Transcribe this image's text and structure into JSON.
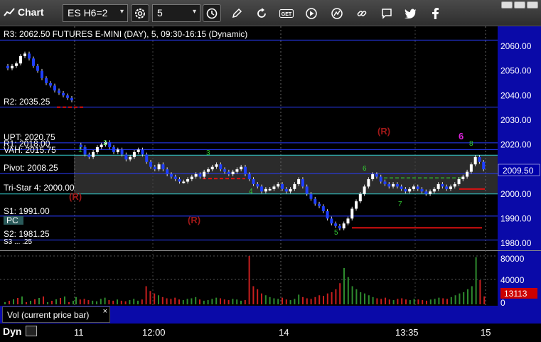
{
  "toolbar": {
    "title": "Chart",
    "symbol": "ES H6=2",
    "interval": "5",
    "icons": [
      "gear-icon",
      "clock-icon",
      "pencil-icon",
      "cycle-icon",
      "get-icon",
      "play-icon",
      "chart-settings-icon",
      "link-icon",
      "chat-icon",
      "twitter-icon",
      "facebook-icon"
    ]
  },
  "chart": {
    "header_text": "R3: 2062.50 FUTURES E-MINI (DAY), 5, 09:30-16:15 (Dynamic)",
    "price_axis": [
      "2060.00",
      "2050.00",
      "2040.00",
      "2030.00",
      "2020.00",
      "2010.00",
      "2000.00",
      "1990.00",
      "1980.00"
    ],
    "current_price": "2009.50",
    "levels": {
      "r2": "R2: 2035.25",
      "upt": "UPT: 2020.75",
      "r1": "R1: 2018.00",
      "vah": "VAH: 2015.75",
      "pivot": "Pivot: 2008.25",
      "tristar": "Tri-Star 4: 2000.00",
      "s1": "S1: 1991.00",
      "s2": "S2: 1981.25",
      "pc": "PC",
      "bottom_small": "S3 ... .25"
    },
    "r_markers": [
      "(R)",
      "(R)",
      "(R)"
    ],
    "vol_axis": [
      "80000",
      "40000",
      "0"
    ],
    "current_volume": "13113",
    "vol_legend": "Vol (current price bar)",
    "vol_close": "×",
    "time_labels": [
      "11",
      "12:00",
      "14",
      "13:35",
      "15"
    ],
    "dyn_label": "Dyn",
    "colors": {
      "up_bar": "#ffffff",
      "down_bar": "#1f3fff",
      "level_blue": "#2a3cff",
      "level_cyan": "#33cccc",
      "red_line": "#dd1111",
      "green_dash": "#2f8a2f",
      "price_flag": "#0000aa",
      "vol_flag": "#cc0000",
      "magenta": "#dd22dd"
    }
  },
  "chart_data": {
    "type": "candlestick",
    "title": "",
    "ylim": [
      1978,
      2066
    ],
    "series": [
      {
        "values": [
          2052,
          2051,
          2052,
          2053,
          2056,
          2057,
          2055,
          2052,
          2050,
          2047,
          2045,
          2044,
          2042,
          2041,
          2040,
          2039,
          2038
        ]
      },
      {
        "values": [
          2020,
          2019,
          2016,
          2015,
          2017,
          2019,
          2020,
          2021,
          2019,
          2017,
          2018,
          2016,
          2014,
          2015,
          2017,
          2018,
          2016,
          2013,
          2011,
          2010,
          2012,
          2010,
          2008,
          2007,
          2006,
          2005,
          2005,
          2006,
          2007,
          2008,
          2007,
          2009,
          2010,
          2011,
          2012,
          2010,
          2009,
          2008,
          2009,
          2010,
          2011,
          2008,
          2006,
          2004,
          2003,
          2001,
          2002,
          2002,
          2003,
          2004,
          2002,
          2001,
          2002,
          2004,
          2006,
          2003,
          2000,
          1998,
          1996,
          1995,
          1993,
          1990,
          1988,
          1987,
          1986,
          1988,
          1990,
          1994,
          1997,
          2000,
          2003,
          2006,
          2008,
          2007,
          2005,
          2004,
          2003,
          2004,
          2003,
          2002,
          2001,
          2002,
          2003,
          2002,
          2001,
          2000,
          2001,
          2002,
          2004,
          2003,
          2002,
          2003,
          2004,
          2006,
          2007,
          2009,
          2012,
          2015,
          2013,
          2010
        ]
      }
    ],
    "volume": [
      12000,
      8000,
      9000,
      7000,
      6000,
      5000,
      9000,
      11000,
      7000,
      6000,
      8000,
      6000,
      5000,
      7000,
      9000,
      6000,
      8000,
      30000,
      22000,
      18000,
      15000,
      12000,
      10000,
      9000,
      11000,
      8000,
      7000,
      9000,
      10000,
      12000,
      8000,
      6000,
      7000,
      9000,
      11000,
      10000,
      8000,
      7000,
      9000,
      8000,
      6000,
      7000,
      80000,
      30000,
      25000,
      18000,
      15000,
      12000,
      10000,
      9000,
      11000,
      8000,
      7000,
      9000,
      16000,
      12000,
      10000,
      9000,
      12000,
      15000,
      14000,
      18000,
      20000,
      25000,
      35000,
      60000,
      45000,
      30000,
      25000,
      20000,
      18000,
      15000,
      12000,
      10000,
      9000,
      11000,
      8000,
      7000,
      9000,
      10000,
      8000,
      7000,
      9000,
      8000,
      7000,
      6000,
      8000,
      9000,
      11000,
      10000,
      9000,
      12000,
      15000,
      18000,
      20000,
      25000,
      30000,
      78000,
      40000,
      13113
    ]
  }
}
